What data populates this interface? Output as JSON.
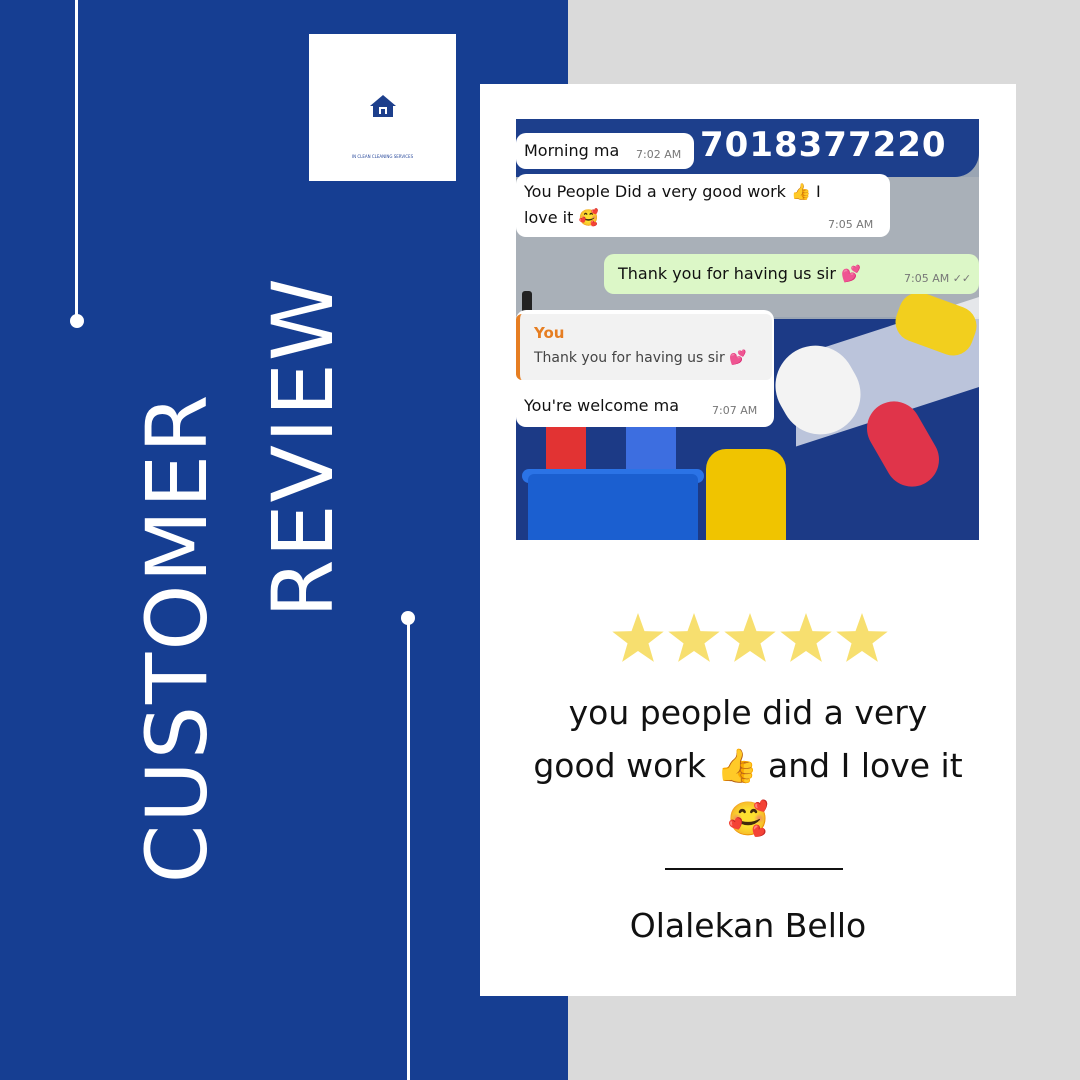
{
  "heading": {
    "line1": "CUSTOMER",
    "line2": "REVIEW"
  },
  "logo": {
    "caption": "IN CLEAN CLEANING SERVICES",
    "icon": "house-icon"
  },
  "screenshot": {
    "banner_phone": "7018377220",
    "messages": [
      {
        "text": "Morning ma",
        "time": "7:02 AM"
      },
      {
        "text": "You People Did a very good work 👍 I",
        "text2": "love it 🥰",
        "time": "7:05 AM"
      },
      {
        "text": "Thank you for having us sir 💕",
        "time": "7:05 AM ✓✓"
      },
      {
        "quote_name": "You",
        "quote_text": "Thank you for having us sir 💕",
        "text": "You're welcome ma",
        "time": "7:07 AM"
      }
    ]
  },
  "rating": {
    "stars": 5,
    "max": 5,
    "color": "#f7df6f"
  },
  "review": {
    "line1": "you people did a very",
    "line2": "good work 👍 and I love it",
    "line3": "🥰"
  },
  "reviewer": {
    "name": "Olalekan Bello"
  },
  "colors": {
    "blue": "#163e92",
    "gray": "#dadada",
    "card": "#ffffff"
  }
}
